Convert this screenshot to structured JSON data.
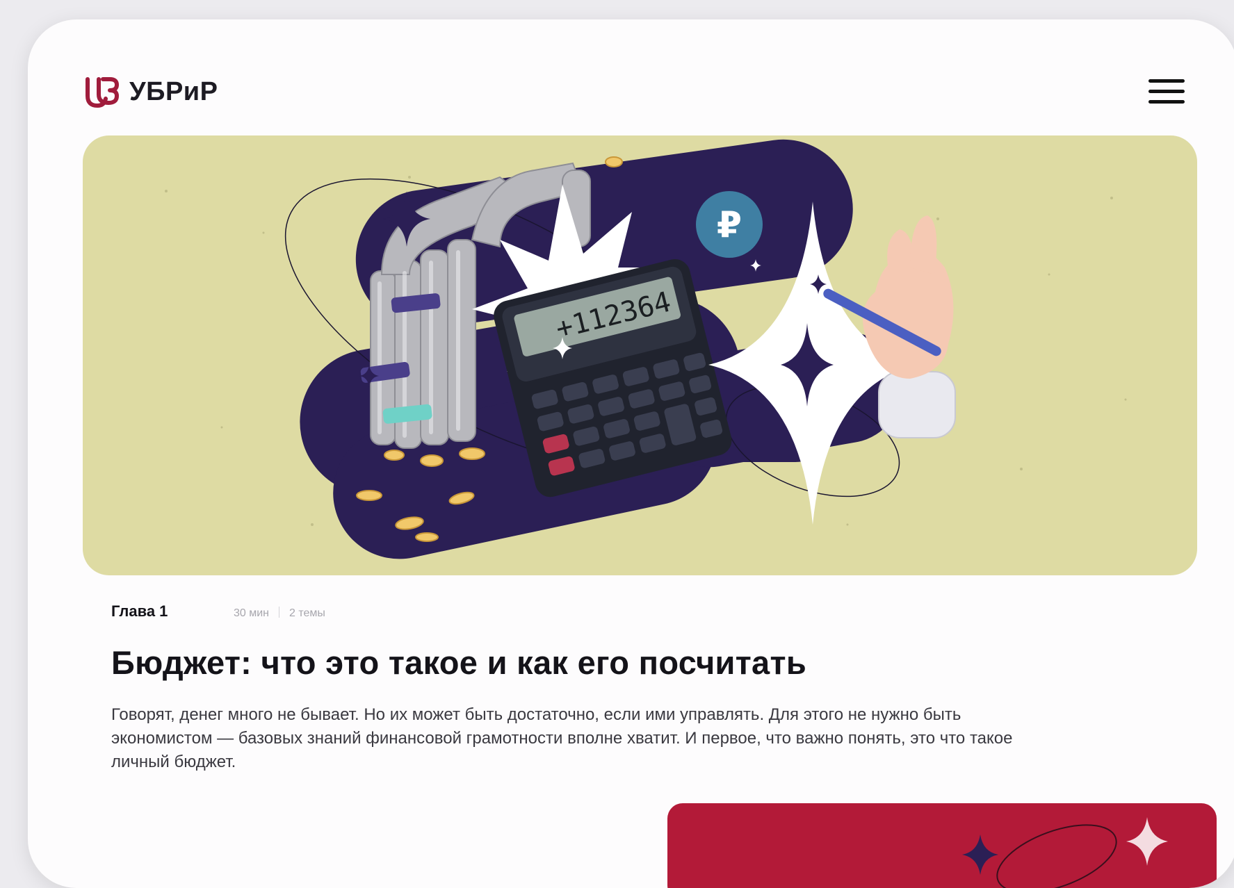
{
  "brand": {
    "name": "УБРиР",
    "color": "#a01c3c"
  },
  "header": {
    "menu_icon": "hamburger-icon"
  },
  "hero": {
    "calculator_display": "+112364",
    "currency_symbol": "₽",
    "colors": {
      "background": "#dedba3",
      "blob": "#2b1f55",
      "coin_badge": "#3f7fa3"
    }
  },
  "lesson": {
    "chapter": "Глава 1",
    "duration": "30 мин",
    "topics": "2 темы",
    "title": "Бюджет: что это такое и как его посчитать",
    "description": "Говорят, денег много не бывает. Но их может быть достаточно, если ими управлять. Для этого не нужно быть экономистом — базовых знаний финансовой грамотности вполне хватит. И первое, что важно понять, это что такое личный бюджет."
  },
  "next_card": {
    "color": "#b31a38"
  }
}
